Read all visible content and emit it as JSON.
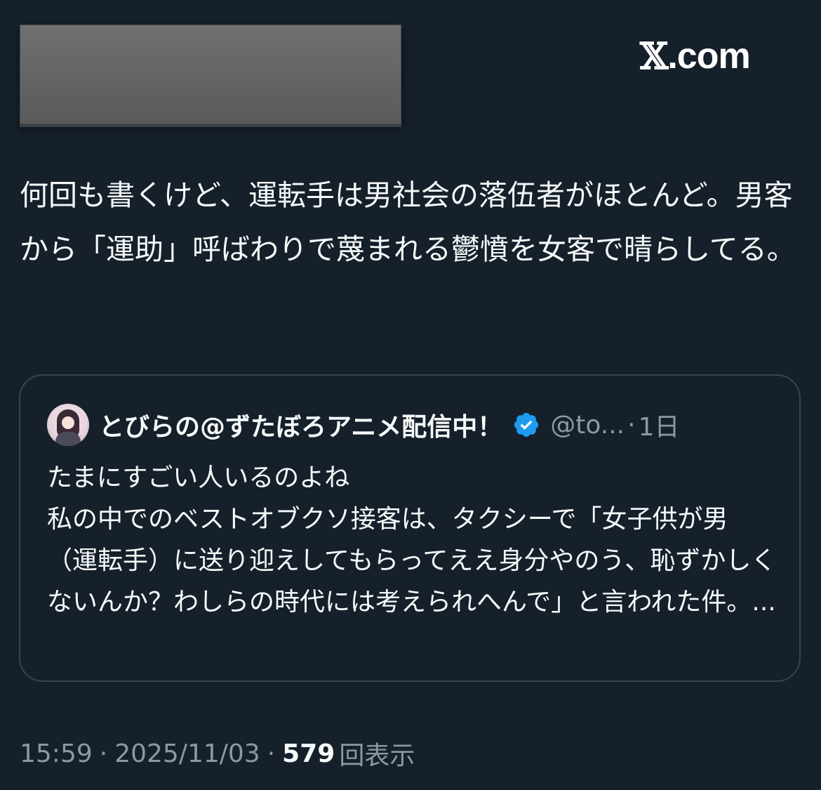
{
  "brand": {
    "x_glyph": "𝕏",
    "label": ".com"
  },
  "tweet": {
    "text": "何回も書くけど、運転手は男社会の落伍者がほとんど。男客から「運助」呼ばわりで蔑まれる鬱憤を女客で晴らしてる。"
  },
  "quote": {
    "display_name": "とびらの@ずたぼろアニメ配信中！",
    "handle": "@to...",
    "separator": "·",
    "time_ago": "1日",
    "text": "たまにすごい人いるのよね\n私の中でのベストオブクソ接客は、タクシーで「女子供が男（運転手）に送り迎えしてもらってええ身分やのう、恥ずかしくないんか？わしらの時代には考えられへんで」と言われた件。..."
  },
  "meta": {
    "time": "15:59",
    "date": "2025/11/03",
    "dot": "·",
    "views_count": "579",
    "views_label": "回表示"
  },
  "colors": {
    "background": "#15202b",
    "text_primary": "#f7f9f9",
    "text_secondary": "#8b98a5",
    "border": "#38444d",
    "verified": "#1d9bf0"
  }
}
